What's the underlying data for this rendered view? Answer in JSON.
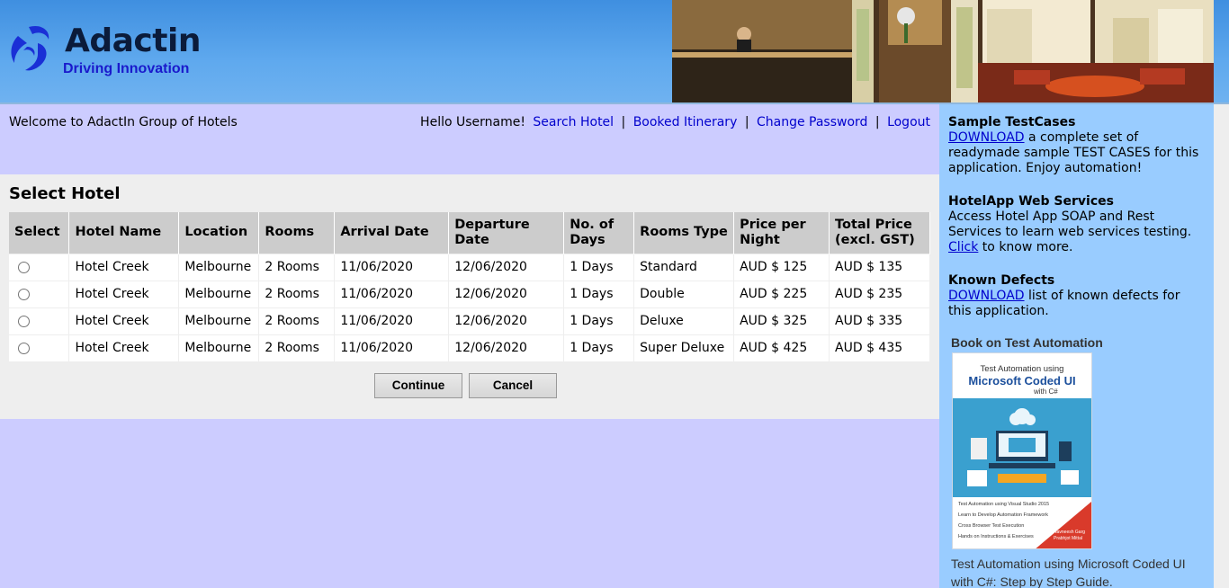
{
  "brand": {
    "name": "Adactin",
    "tagline": "Driving Innovation"
  },
  "top": {
    "welcome": "Welcome to AdactIn Group of Hotels",
    "greeting": "Hello Username!",
    "separator": "|",
    "links": {
      "search_hotel": "Search Hotel",
      "booked_itinerary": "Booked Itinerary",
      "change_password": "Change Password",
      "logout": "Logout"
    }
  },
  "main": {
    "title": "Select Hotel",
    "columns": [
      "Select",
      "Hotel Name",
      "Location",
      "Rooms",
      "Arrival Date",
      "Departure Date",
      "No. of Days",
      "Rooms Type",
      "Price per Night",
      "Total Price (excl. GST)"
    ],
    "rows": [
      {
        "hotel": "Hotel Creek",
        "location": "Melbourne",
        "rooms": "2 Rooms",
        "arrival": "11/06/2020",
        "departure": "12/06/2020",
        "days": "1 Days",
        "type": "Standard",
        "price": "AUD $ 125",
        "total": "AUD $ 135"
      },
      {
        "hotel": "Hotel Creek",
        "location": "Melbourne",
        "rooms": "2 Rooms",
        "arrival": "11/06/2020",
        "departure": "12/06/2020",
        "days": "1 Days",
        "type": "Double",
        "price": "AUD $ 225",
        "total": "AUD $ 235"
      },
      {
        "hotel": "Hotel Creek",
        "location": "Melbourne",
        "rooms": "2 Rooms",
        "arrival": "11/06/2020",
        "departure": "12/06/2020",
        "days": "1 Days",
        "type": "Deluxe",
        "price": "AUD $ 325",
        "total": "AUD $ 335"
      },
      {
        "hotel": "Hotel Creek",
        "location": "Melbourne",
        "rooms": "2 Rooms",
        "arrival": "11/06/2020",
        "departure": "12/06/2020",
        "days": "1 Days",
        "type": "Super Deluxe",
        "price": "AUD $ 425",
        "total": "AUD $ 435"
      }
    ],
    "continue_label": "Continue",
    "cancel_label": "Cancel"
  },
  "sidebar": {
    "testcases_heading": "Sample TestCases",
    "testcases_link": "DOWNLOAD",
    "testcases_text": " a complete set of readymade sample TEST CASES for this application. Enjoy automation!",
    "webservices_heading": "HotelApp Web Services",
    "webservices_text": "Access Hotel App SOAP and Rest Services to learn web services testing.",
    "webservices_link": "Click",
    "webservices_text2": " to know more.",
    "defects_heading": "Known Defects",
    "defects_link": "DOWNLOAD",
    "defects_text": " list of known defects for this application.",
    "book_heading": "Book on Test Automation",
    "book_cover": {
      "line1": "Test Automation using",
      "line2": "Microsoft Coded UI",
      "line3": "with C#",
      "bullets": [
        "Test Automation using Visual Studio 2015",
        "Learn to Develop Automation Framework",
        "Cross Browser Test Execution",
        "Hands on Instructions & Exercises"
      ],
      "authors": [
        "Navneesh Garg",
        "Prabhjot Mittal"
      ]
    },
    "book_caption": "Test Automation using Microsoft Coded UI with C#: Step by Step Guide."
  },
  "colors": {
    "header_blue": "#5fa9ee",
    "page_lavender": "#ccccff",
    "sidebar_blue": "#99ccff",
    "link_blue": "#0000cc"
  }
}
